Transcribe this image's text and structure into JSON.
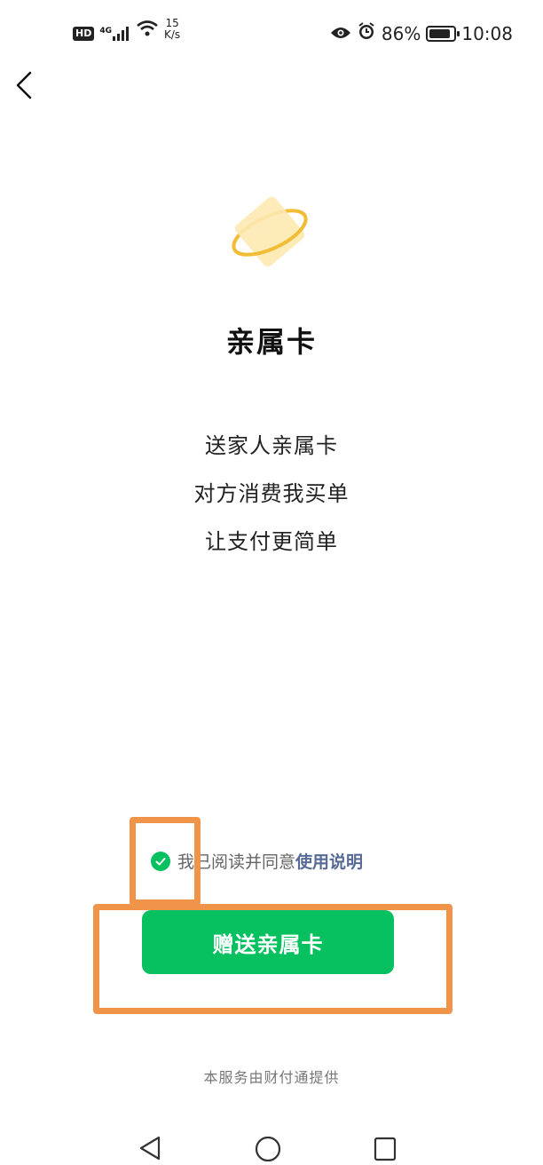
{
  "status_bar": {
    "hd": "HD",
    "network": "4G",
    "speed_value": "15",
    "speed_unit": "K/s",
    "battery_percent": "86%",
    "battery_level": 0.86,
    "time": "10:08"
  },
  "header": {
    "back_icon": "chevron-left-icon"
  },
  "hero": {
    "logo_icon": "card-ring-icon",
    "title": "亲属卡",
    "lines": [
      "送家人亲属卡",
      "对方消费我买单",
      "让支付更简单"
    ]
  },
  "agreement": {
    "checked": true,
    "text": "我已阅读并同意",
    "link": "使用说明"
  },
  "primary_button": {
    "label": "赠送亲属卡"
  },
  "footer": {
    "text": "本服务由财付通提供"
  },
  "colors": {
    "accent": "#07c160",
    "link": "#576b95",
    "highlight": "#f0944a"
  }
}
